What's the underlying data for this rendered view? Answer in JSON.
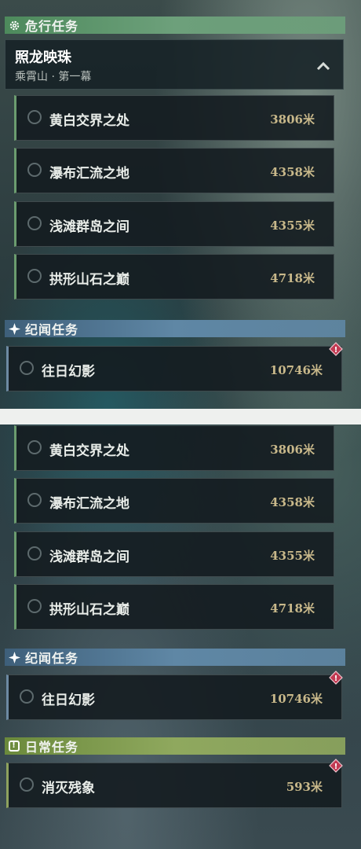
{
  "colors": {
    "danger_header": "#6da07b",
    "legend_header": "#5f87a5",
    "daily_header": "#8fa85e",
    "distance_text": "#c8b88a",
    "alert_badge": "#c23a52"
  },
  "top": {
    "danger_category": {
      "label": "危行任务",
      "icon": "gear-icon"
    },
    "main_quest": {
      "title": "照龙映珠",
      "subtitle": "乘霄山 · 第一幕",
      "icon": "chevron-up-icon"
    },
    "subtasks": [
      {
        "name": "黄白交界之处",
        "distance": "3806米"
      },
      {
        "name": "瀑布汇流之地",
        "distance": "4358米"
      },
      {
        "name": "浅滩群岛之间",
        "distance": "4355米"
      },
      {
        "name": "拱形山石之巅",
        "distance": "4718米"
      }
    ],
    "legend_category": {
      "label": "纪闻任务",
      "icon": "sparkle-icon"
    },
    "legend_tasks": [
      {
        "name": "往日幻影",
        "distance": "10746米",
        "alert": "!"
      }
    ]
  },
  "bottom": {
    "subtasks": [
      {
        "name": "黄白交界之处",
        "distance": "3806米"
      },
      {
        "name": "瀑布汇流之地",
        "distance": "4358米"
      },
      {
        "name": "浅滩群岛之间",
        "distance": "4355米"
      },
      {
        "name": "拱形山石之巅",
        "distance": "4718米"
      }
    ],
    "legend_category": {
      "label": "纪闻任务",
      "icon": "sparkle-icon"
    },
    "legend_tasks": [
      {
        "name": "往日幻影",
        "distance": "10746米",
        "alert": "!"
      }
    ],
    "daily_category": {
      "label": "日常任务",
      "icon": "exclamation-box-icon",
      "icon_glyph": "!"
    },
    "daily_tasks": [
      {
        "name": "消灭残象",
        "distance": "593米",
        "alert": "!"
      }
    ]
  }
}
